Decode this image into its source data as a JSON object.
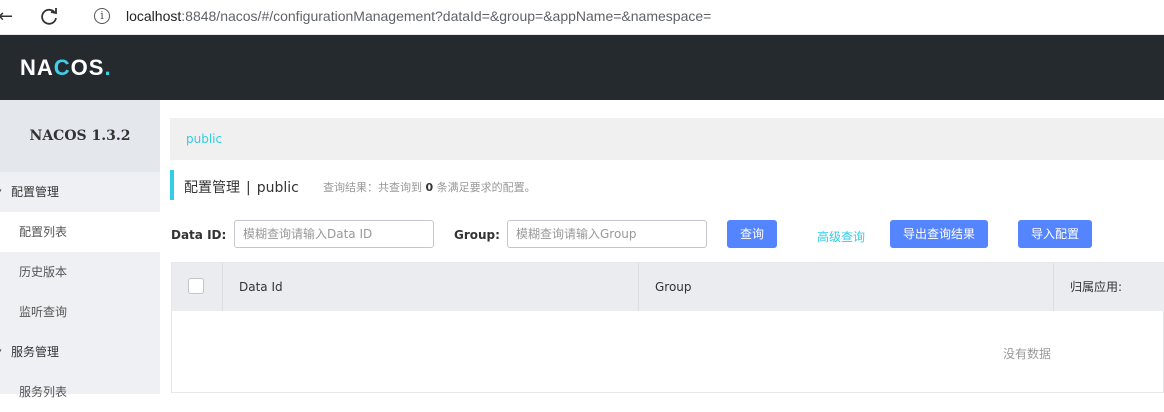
{
  "browser": {
    "url_host": "localhost",
    "url_rest": ":8848/nacos/#/configurationManagement?dataId=&group=&appName=&namespace="
  },
  "header": {
    "logo_pre": "NA",
    "logo_c": "C",
    "logo_post": "OS",
    "logo_dot": "."
  },
  "sidebar": {
    "version": "NACOS 1.3.2",
    "groups": [
      {
        "label": "配置管理",
        "items": [
          "配置列表",
          "历史版本",
          "监听查询"
        ]
      },
      {
        "label": "服务管理",
        "items": [
          "服务列表"
        ]
      }
    ],
    "active_item": "配置列表"
  },
  "namespace": {
    "current": "public"
  },
  "page": {
    "title": "配置管理",
    "separator": "|",
    "namespace": "public",
    "hint_pre": "查询结果：共查询到",
    "hint_count": "0",
    "hint_post": "条满足要求的配置。"
  },
  "search": {
    "dataid_label": "Data ID:",
    "dataid_placeholder": "模糊查询请输入Data ID",
    "group_label": "Group:",
    "group_placeholder": "模糊查询请输入Group",
    "query_button": "查询",
    "advanced_link": "高级查询",
    "export_button": "导出查询结果",
    "import_button": "导入配置"
  },
  "table": {
    "columns": [
      "Data Id",
      "Group",
      "归属应用:"
    ],
    "empty_text": "没有数据"
  },
  "colors": {
    "topbar": "#252a2f",
    "accent": "#33cde5",
    "primary_button": "#5584ff"
  }
}
